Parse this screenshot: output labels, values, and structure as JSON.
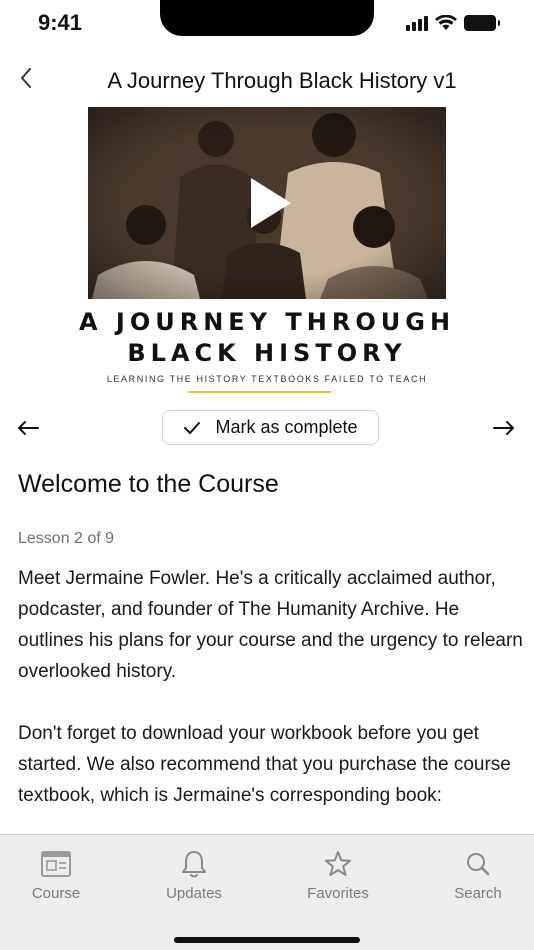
{
  "status_bar": {
    "time": "9:41"
  },
  "header": {
    "title": "A Journey Through Black History v1"
  },
  "video": {
    "cover_title_line1": "A JOURNEY THROUGH",
    "cover_title_line2": "BLACK HISTORY",
    "cover_subtitle": "LEARNING THE HISTORY TEXTBOOKS FAILED TO TEACH",
    "accent_color": "#e6c440"
  },
  "lesson_nav": {
    "mark_complete_label": "Mark as complete"
  },
  "lesson": {
    "heading": "Welcome to the Course",
    "counter": "Lesson 2 of 9",
    "paragraph1": "Meet Jermaine Fowler. He's a critically acclaimed author, podcaster, and founder of The Humanity Archive. He outlines his plans for your course and the urgency to relearn overlooked history.",
    "paragraph2": "Don't forget to download your workbook before you get started. We also recommend that you purchase the course textbook, which is Jermaine's corresponding book:"
  },
  "tab_bar": {
    "items": [
      {
        "label": "Course",
        "icon": "course-icon"
      },
      {
        "label": "Updates",
        "icon": "bell-icon"
      },
      {
        "label": "Favorites",
        "icon": "star-icon"
      },
      {
        "label": "Search",
        "icon": "search-icon"
      }
    ]
  }
}
